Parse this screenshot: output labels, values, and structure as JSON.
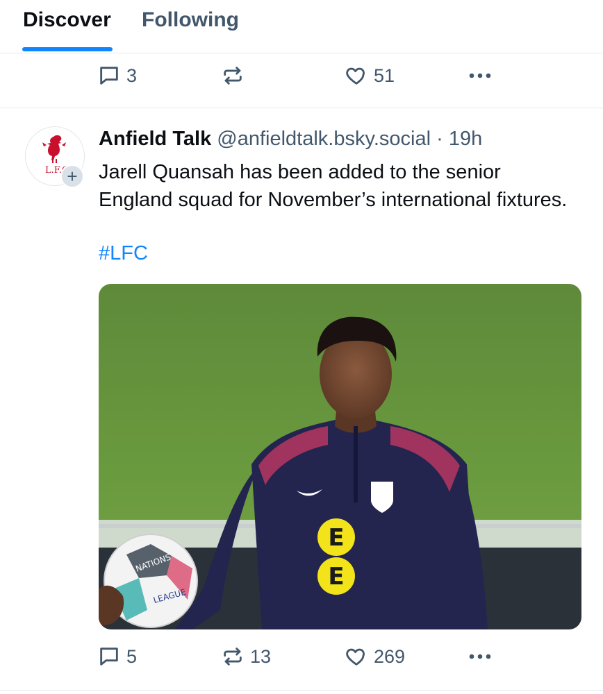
{
  "tabs": [
    {
      "label": "Discover",
      "active": true
    },
    {
      "label": "Following",
      "active": false
    }
  ],
  "colors": {
    "accent": "#1185fe",
    "muted": "#42576c",
    "text": "#0b0f14",
    "divider": "#e4e8ec"
  },
  "previous_post": {
    "actions": {
      "reply_count": "3",
      "repost_count": "",
      "like_count": "51"
    }
  },
  "post": {
    "avatar": {
      "text": "L.F.C",
      "icon": "liverbird-crest"
    },
    "author_name": "Anfield Talk",
    "author_handle": "@anfieldtalk.bsky.social",
    "separator": "·",
    "time": "19h",
    "text": "Jarell Quansah has been added to the senior England squad for November’s international fixtures.",
    "hashtag": "#LFC",
    "image": {
      "subject": "footballer-in-training-kit-holding-ball",
      "shirt_sponsor": "EE",
      "ball_text": [
        "NATIONS",
        "LEAGUE"
      ]
    },
    "actions": {
      "reply_count": "5",
      "repost_count": "13",
      "like_count": "269"
    }
  },
  "icons": {
    "reply": "speech-bubble-icon",
    "repost": "repost-arrows-icon",
    "like": "heart-icon",
    "more": "ellipsis-icon"
  }
}
